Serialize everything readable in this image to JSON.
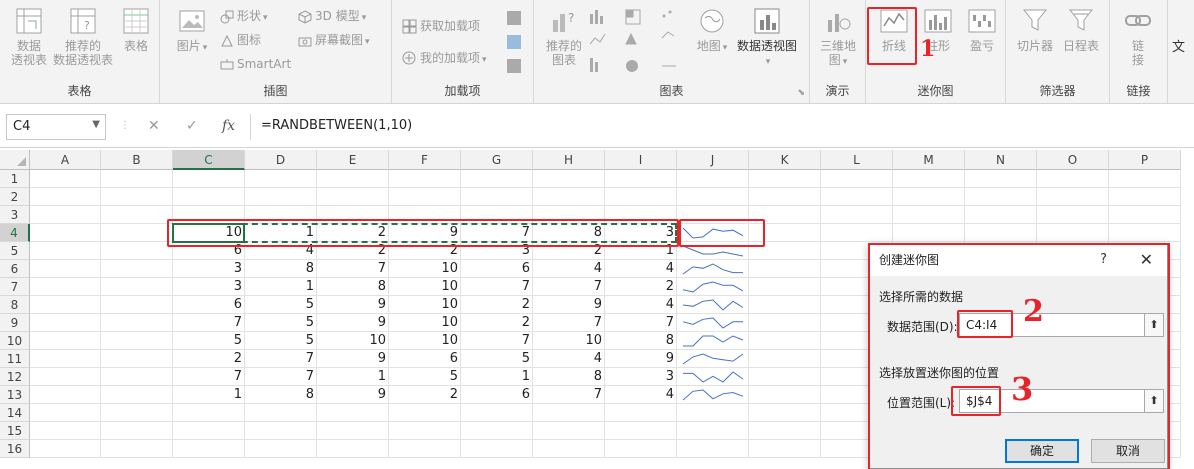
{
  "ribbon": {
    "groups": {
      "tables": {
        "label": "表格",
        "pivot": "数据\n透视表",
        "recommended_pivot": "推荐的\n数据透视表",
        "table": "表格"
      },
      "illustrations": {
        "label": "插图",
        "pictures": "图片",
        "shapes": "形状",
        "icons": "图标",
        "models3d": "3D 模型",
        "screenshot": "屏幕截图",
        "smartart": "SmartArt"
      },
      "addins": {
        "label": "加载项",
        "get_addins": "获取加载项",
        "my_addins": "我的加载项"
      },
      "charts": {
        "label": "图表",
        "recommended_charts": "推荐的\n图表",
        "maps": "地图",
        "pivot_chart": "数据透视图"
      },
      "tours": {
        "label": "演示",
        "map3d": "三维地\n图"
      },
      "sparklines": {
        "label": "迷你图",
        "line": "折线",
        "column": "柱形",
        "winloss": "盈亏"
      },
      "filters": {
        "label": "筛选器",
        "slicer": "切片器",
        "timeline": "日程表"
      },
      "links": {
        "label": "链接",
        "link": "链\n接"
      }
    },
    "edge_text": "文"
  },
  "formula_bar": {
    "name_box": "C4",
    "cancel_glyph": "✕",
    "enter_glyph": "✓",
    "fx_glyph": "fx",
    "formula": "=RANDBETWEEN(1,10)"
  },
  "sheet": {
    "columns": [
      "A",
      "B",
      "C",
      "D",
      "E",
      "F",
      "G",
      "H",
      "I",
      "J",
      "K",
      "L",
      "M",
      "N",
      "O",
      "P"
    ],
    "rows": [
      "1",
      "2",
      "3",
      "4",
      "5",
      "6",
      "7",
      "8",
      "9",
      "10",
      "11",
      "12",
      "13",
      "14",
      "15",
      "16"
    ],
    "data_start_row": 4,
    "data_columns": [
      "C",
      "D",
      "E",
      "F",
      "G",
      "H",
      "I"
    ],
    "values": [
      [
        10,
        1,
        2,
        9,
        7,
        8,
        3
      ],
      [
        6,
        4,
        2,
        2,
        3,
        2,
        1
      ],
      [
        3,
        8,
        7,
        10,
        6,
        4,
        4
      ],
      [
        3,
        1,
        8,
        10,
        7,
        7,
        2
      ],
      [
        6,
        5,
        9,
        10,
        2,
        9,
        4
      ],
      [
        7,
        5,
        9,
        10,
        2,
        7,
        7
      ],
      [
        5,
        5,
        10,
        10,
        7,
        10,
        8
      ],
      [
        2,
        7,
        9,
        6,
        5,
        4,
        9
      ],
      [
        7,
        7,
        1,
        5,
        1,
        8,
        3
      ],
      [
        1,
        8,
        9,
        2,
        6,
        7,
        4
      ]
    ],
    "sparkline_color": "#4472c4"
  },
  "dialog": {
    "title": "创建迷你图",
    "help": "?",
    "close": "✕",
    "section1": "选择所需的数据",
    "data_range_label": "数据范围(D):",
    "data_range_value": "C4:I4",
    "section2": "选择放置迷你图的位置",
    "location_label": "位置范围(L):",
    "location_value": "$J$4",
    "ok": "确定",
    "cancel": "取消"
  },
  "annotations": {
    "mark1": "1",
    "mark2": "2",
    "mark3": "3",
    "color": "#e8232a"
  }
}
